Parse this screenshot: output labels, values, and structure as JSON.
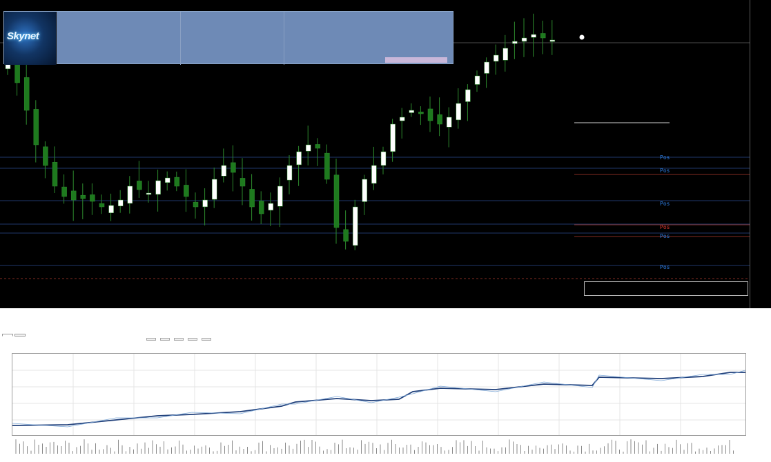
{
  "chart": {
    "title": "",
    "corner_label": "",
    "bottom_left_1": "",
    "bottom_left_2": "",
    "white_line_label": "",
    "red_line_label": "",
    "red_line_label2": "",
    "level_tags": [
      {
        "text": "Pos",
        "color": "blue"
      },
      {
        "text": "Pos",
        "color": "blue"
      },
      {
        "text": "Pos",
        "color": "blue"
      },
      {
        "text": "Pos",
        "color": "red"
      },
      {
        "text": "Pos",
        "color": "blue"
      },
      {
        "text": "Pos",
        "color": "blue"
      }
    ],
    "price_labels": [
      "",
      "",
      "",
      "",
      "",
      "",
      "",
      "",
      "",
      "",
      "",
      "",
      "",
      ""
    ],
    "time_labels": [
      "",
      "",
      "",
      "",
      "",
      "",
      "",
      "",
      "",
      "",
      "",
      "",
      "",
      "",
      "",
      "",
      "",
      "",
      ""
    ],
    "colors": {
      "bull": "#ffffff",
      "bear": "#1e7a1e",
      "wick": "#2d8a2d",
      "red_line": "#b03a2e",
      "blue_line": "#2a4d8f",
      "white_line": "#9a9a9a"
    }
  },
  "panel": {
    "logo_text": "Skynet",
    "logo_sub": "",
    "columns": [
      {
        "rows": [
          [
            "",
            ""
          ],
          [
            "",
            ""
          ],
          [
            "",
            ""
          ],
          [
            "",
            ""
          ],
          [
            "",
            ""
          ],
          [
            "",
            ""
          ],
          [
            "",
            ""
          ]
        ]
      },
      {
        "rows": [
          [
            "",
            ""
          ],
          [
            "",
            ""
          ],
          [
            "",
            ""
          ],
          [
            "",
            ""
          ],
          [
            "",
            ""
          ],
          [
            "",
            ""
          ],
          [
            "",
            ""
          ]
        ]
      },
      {
        "rows": [
          [
            "",
            ""
          ],
          [
            "",
            ""
          ],
          [
            "",
            ""
          ],
          [
            "",
            ""
          ],
          [
            "",
            ""
          ],
          [
            "",
            ""
          ],
          [
            "",
            ""
          ]
        ]
      }
    ]
  },
  "report": {
    "tab_left": [
      "",
      ""
    ],
    "tab_right": [
      "",
      "",
      "",
      "",
      ""
    ],
    "legend_text": "",
    "y_labels": [
      "",
      "",
      "",
      "",
      ""
    ],
    "x_labels": [
      "",
      "",
      "",
      "",
      "",
      "",
      "",
      "",
      "",
      "",
      "",
      "",
      "",
      "",
      "",
      "",
      "",
      "",
      "",
      "",
      "",
      "",
      "",
      "",
      "",
      "",
      "",
      "",
      "",
      "",
      "",
      "",
      "",
      "",
      "",
      "",
      "",
      "",
      "",
      ""
    ],
    "vol_label": "",
    "watermark": ""
  }
}
